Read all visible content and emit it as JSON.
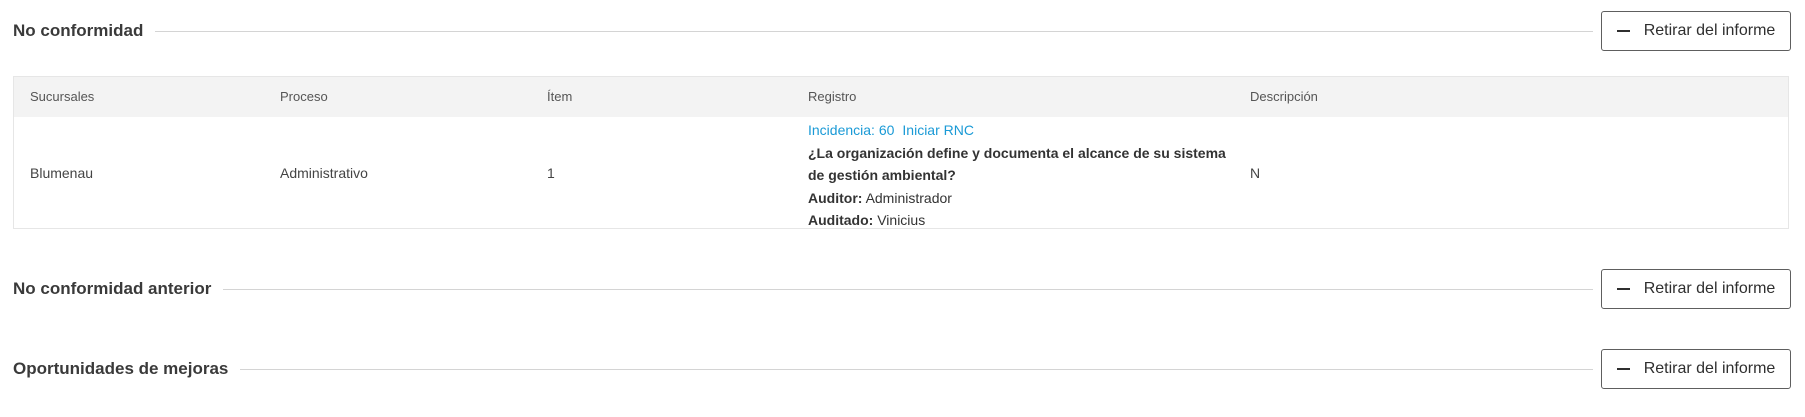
{
  "sections": {
    "no_conformidad": {
      "title": "No conformidad",
      "button_label": "Retirar del informe"
    },
    "no_conformidad_anterior": {
      "title": "No conformidad anterior",
      "button_label": "Retirar del informe"
    },
    "oportunidades": {
      "title": "Oportunidades de mejoras",
      "button_label": "Retirar del informe"
    }
  },
  "table": {
    "headers": [
      "Sucursales",
      "Proceso",
      "Ítem",
      "Registro",
      "Descripción"
    ],
    "rows": [
      {
        "sucursal": "Blumenau",
        "proceso": "Administrativo",
        "item": "1",
        "registro": {
          "incidencia_link": "Incidencia: 60",
          "iniciar_link": "Iniciar RNC",
          "question": "¿La organización define y documenta el alcance de su sistema de gestión ambiental?",
          "auditor_label": "Auditor:",
          "auditor_value": "Administrador",
          "auditado_label": "Auditado:",
          "auditado_value": "Vinicius"
        },
        "descripcion": "N"
      }
    ]
  },
  "icons": {
    "remove_button_icon": "minus-icon"
  }
}
